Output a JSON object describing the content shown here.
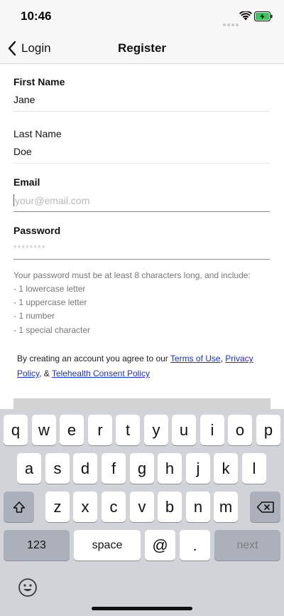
{
  "status_bar": {
    "time": "10:46",
    "icons": [
      "cellular-dots-icon",
      "wifi-icon",
      "battery-charging-icon"
    ]
  },
  "nav": {
    "back_label": "Login",
    "title": "Register",
    "back_icon": "chevron-left-icon"
  },
  "form": {
    "first_name": {
      "label": "First Name",
      "value": "Jane"
    },
    "last_name": {
      "label": "Last Name",
      "value": "Doe"
    },
    "email": {
      "label": "Email",
      "value": "",
      "placeholder": "your@email.com"
    },
    "password": {
      "label": "Password",
      "placeholder": "********"
    }
  },
  "password_hint": {
    "intro": "Your password must be at least 8 characters long, and include:",
    "rules": [
      "- 1 lowercase letter",
      "- 1 uppercase letter",
      "- 1 number",
      "- 1 special character"
    ]
  },
  "terms": {
    "prefix": "By creating an account you agree to our ",
    "terms_link": "Terms of Use",
    "sep1": ", ",
    "privacy_link": "Privacy Policy",
    "sep2": ", & ",
    "telehealth_link": "Telehealth Consent Policy"
  },
  "keyboard": {
    "row1": [
      "q",
      "w",
      "e",
      "r",
      "t",
      "y",
      "u",
      "i",
      "o",
      "p"
    ],
    "row2": [
      "a",
      "s",
      "d",
      "f",
      "g",
      "h",
      "j",
      "k",
      "l"
    ],
    "row3": [
      "z",
      "x",
      "c",
      "v",
      "b",
      "n",
      "m"
    ],
    "numbers_key": "123",
    "space_key": "space",
    "at_key": "@",
    "dot_key": ".",
    "next_key": "next",
    "shift_icon": "shift-icon",
    "delete_icon": "backspace-icon",
    "emoji_icon": "emoji-icon"
  },
  "colors": {
    "link": "#1a2fd6",
    "keyboard_bg": "#d1d3d9",
    "battery": "#34c759"
  }
}
